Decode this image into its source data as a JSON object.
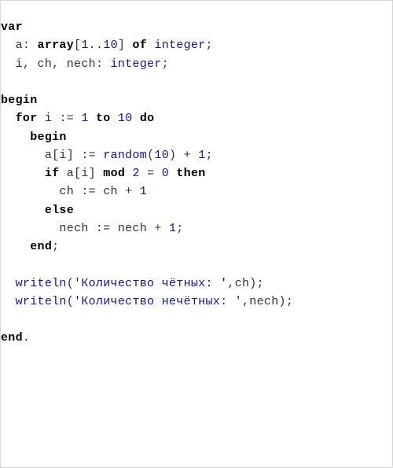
{
  "code": {
    "l01_kw_var": "var",
    "l02_id_a": "a",
    "l02_kw_array": "array",
    "l02_range": "1..10",
    "l02_kw_of": "of",
    "l02_ty_integer": "integer",
    "l03_ids": "i, ch, nech",
    "l03_ty_integer": "integer",
    "l05_kw_begin": "begin",
    "l06_kw_for": "for",
    "l06_id_i": "i",
    "l06_num_1": "1",
    "l06_kw_to": "to",
    "l06_num_10": "10",
    "l06_kw_do": "do",
    "l07_kw_begin": "begin",
    "l08_lhs": "a[i]",
    "l08_fn_random": "random",
    "l08_num_10": "10",
    "l08_num_1": "1",
    "l09_kw_if": "if",
    "l09_expr_ai": "a[i]",
    "l09_kw_mod": "mod",
    "l09_num_2": "2",
    "l09_eq": "=",
    "l09_num_0": "0",
    "l09_kw_then": "then",
    "l10_assign": "ch := ch + ",
    "l10_num_1": "1",
    "l11_kw_else": "else",
    "l12_assign": "nech := nech + ",
    "l12_num_1": "1",
    "l13_kw_end": "end",
    "l15_fn_writeln": "writeln",
    "l15_str": "'Количество чётных: '",
    "l15_arg": ",ch",
    "l16_fn_writeln": "writeln",
    "l16_str": "'Количество нечётных: '",
    "l16_arg": ",nech",
    "l18_kw_end": "end"
  }
}
